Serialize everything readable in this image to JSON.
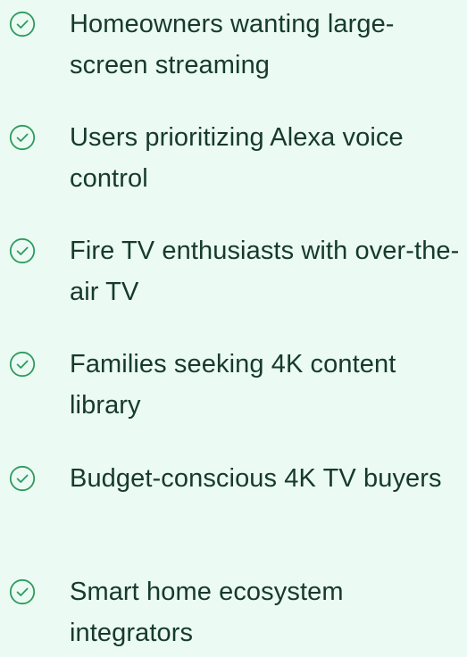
{
  "audience_list": {
    "items": [
      {
        "icon": "check-circle-icon",
        "label": "Homeowners wanting large-screen streaming"
      },
      {
        "icon": "check-circle-icon",
        "label": "Users prioritizing Alexa voice control"
      },
      {
        "icon": "check-circle-icon",
        "label": "Fire TV enthusiasts with over-the-air TV"
      },
      {
        "icon": "check-circle-icon",
        "label": "Families seeking 4K content library"
      },
      {
        "icon": "check-circle-icon",
        "label": "Budget-conscious 4K TV buyers"
      },
      {
        "icon": "check-circle-icon",
        "label": "Smart home ecosystem integrators"
      }
    ],
    "icon_color": "#2e9b5e",
    "text_color": "#163a2c",
    "background": "#ebfaf3"
  }
}
